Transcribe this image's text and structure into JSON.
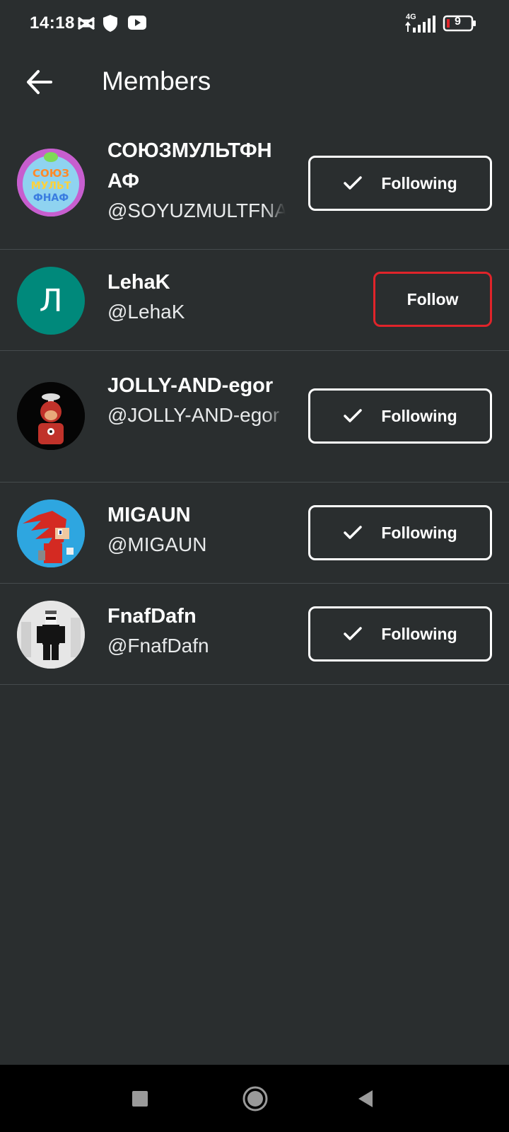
{
  "status_bar": {
    "time": "14:18",
    "network": "4G",
    "battery": "9",
    "icons": [
      "capcut-icon",
      "shield-icon",
      "youtube-icon",
      "signal-icon",
      "battery-icon"
    ]
  },
  "header": {
    "title": "Members",
    "back_icon": "arrow-left-icon"
  },
  "members": [
    {
      "name": "СОЮЗМУЛЬТФНАФ",
      "handle": "@SOYUZMULTFNAF",
      "button": "Following",
      "following": true,
      "avatar_text": "СОЮЗ МУЛЬТ ФНАФ"
    },
    {
      "name": "LehaK",
      "handle": "@LehaK",
      "button": "Follow",
      "following": false,
      "avatar_letter": "Л",
      "avatar_color": "#00897b"
    },
    {
      "name": "JOLLY-AND-egor",
      "handle": "@JOLLY-AND-egor",
      "button": "Following",
      "following": true
    },
    {
      "name": "MIGAUN",
      "handle": "@MIGAUN",
      "button": "Following",
      "following": true
    },
    {
      "name": "FnafDafn",
      "handle": "@FnafDafn",
      "button": "Following",
      "following": true
    }
  ],
  "colors": {
    "background": "#2a2e2f",
    "divider": "#454b4d",
    "follow_border": "#e0242a",
    "following_border": "#ffffff"
  },
  "nav_bar": {
    "icons": [
      "recents-square-icon",
      "home-circle-icon",
      "back-triangle-icon"
    ]
  }
}
